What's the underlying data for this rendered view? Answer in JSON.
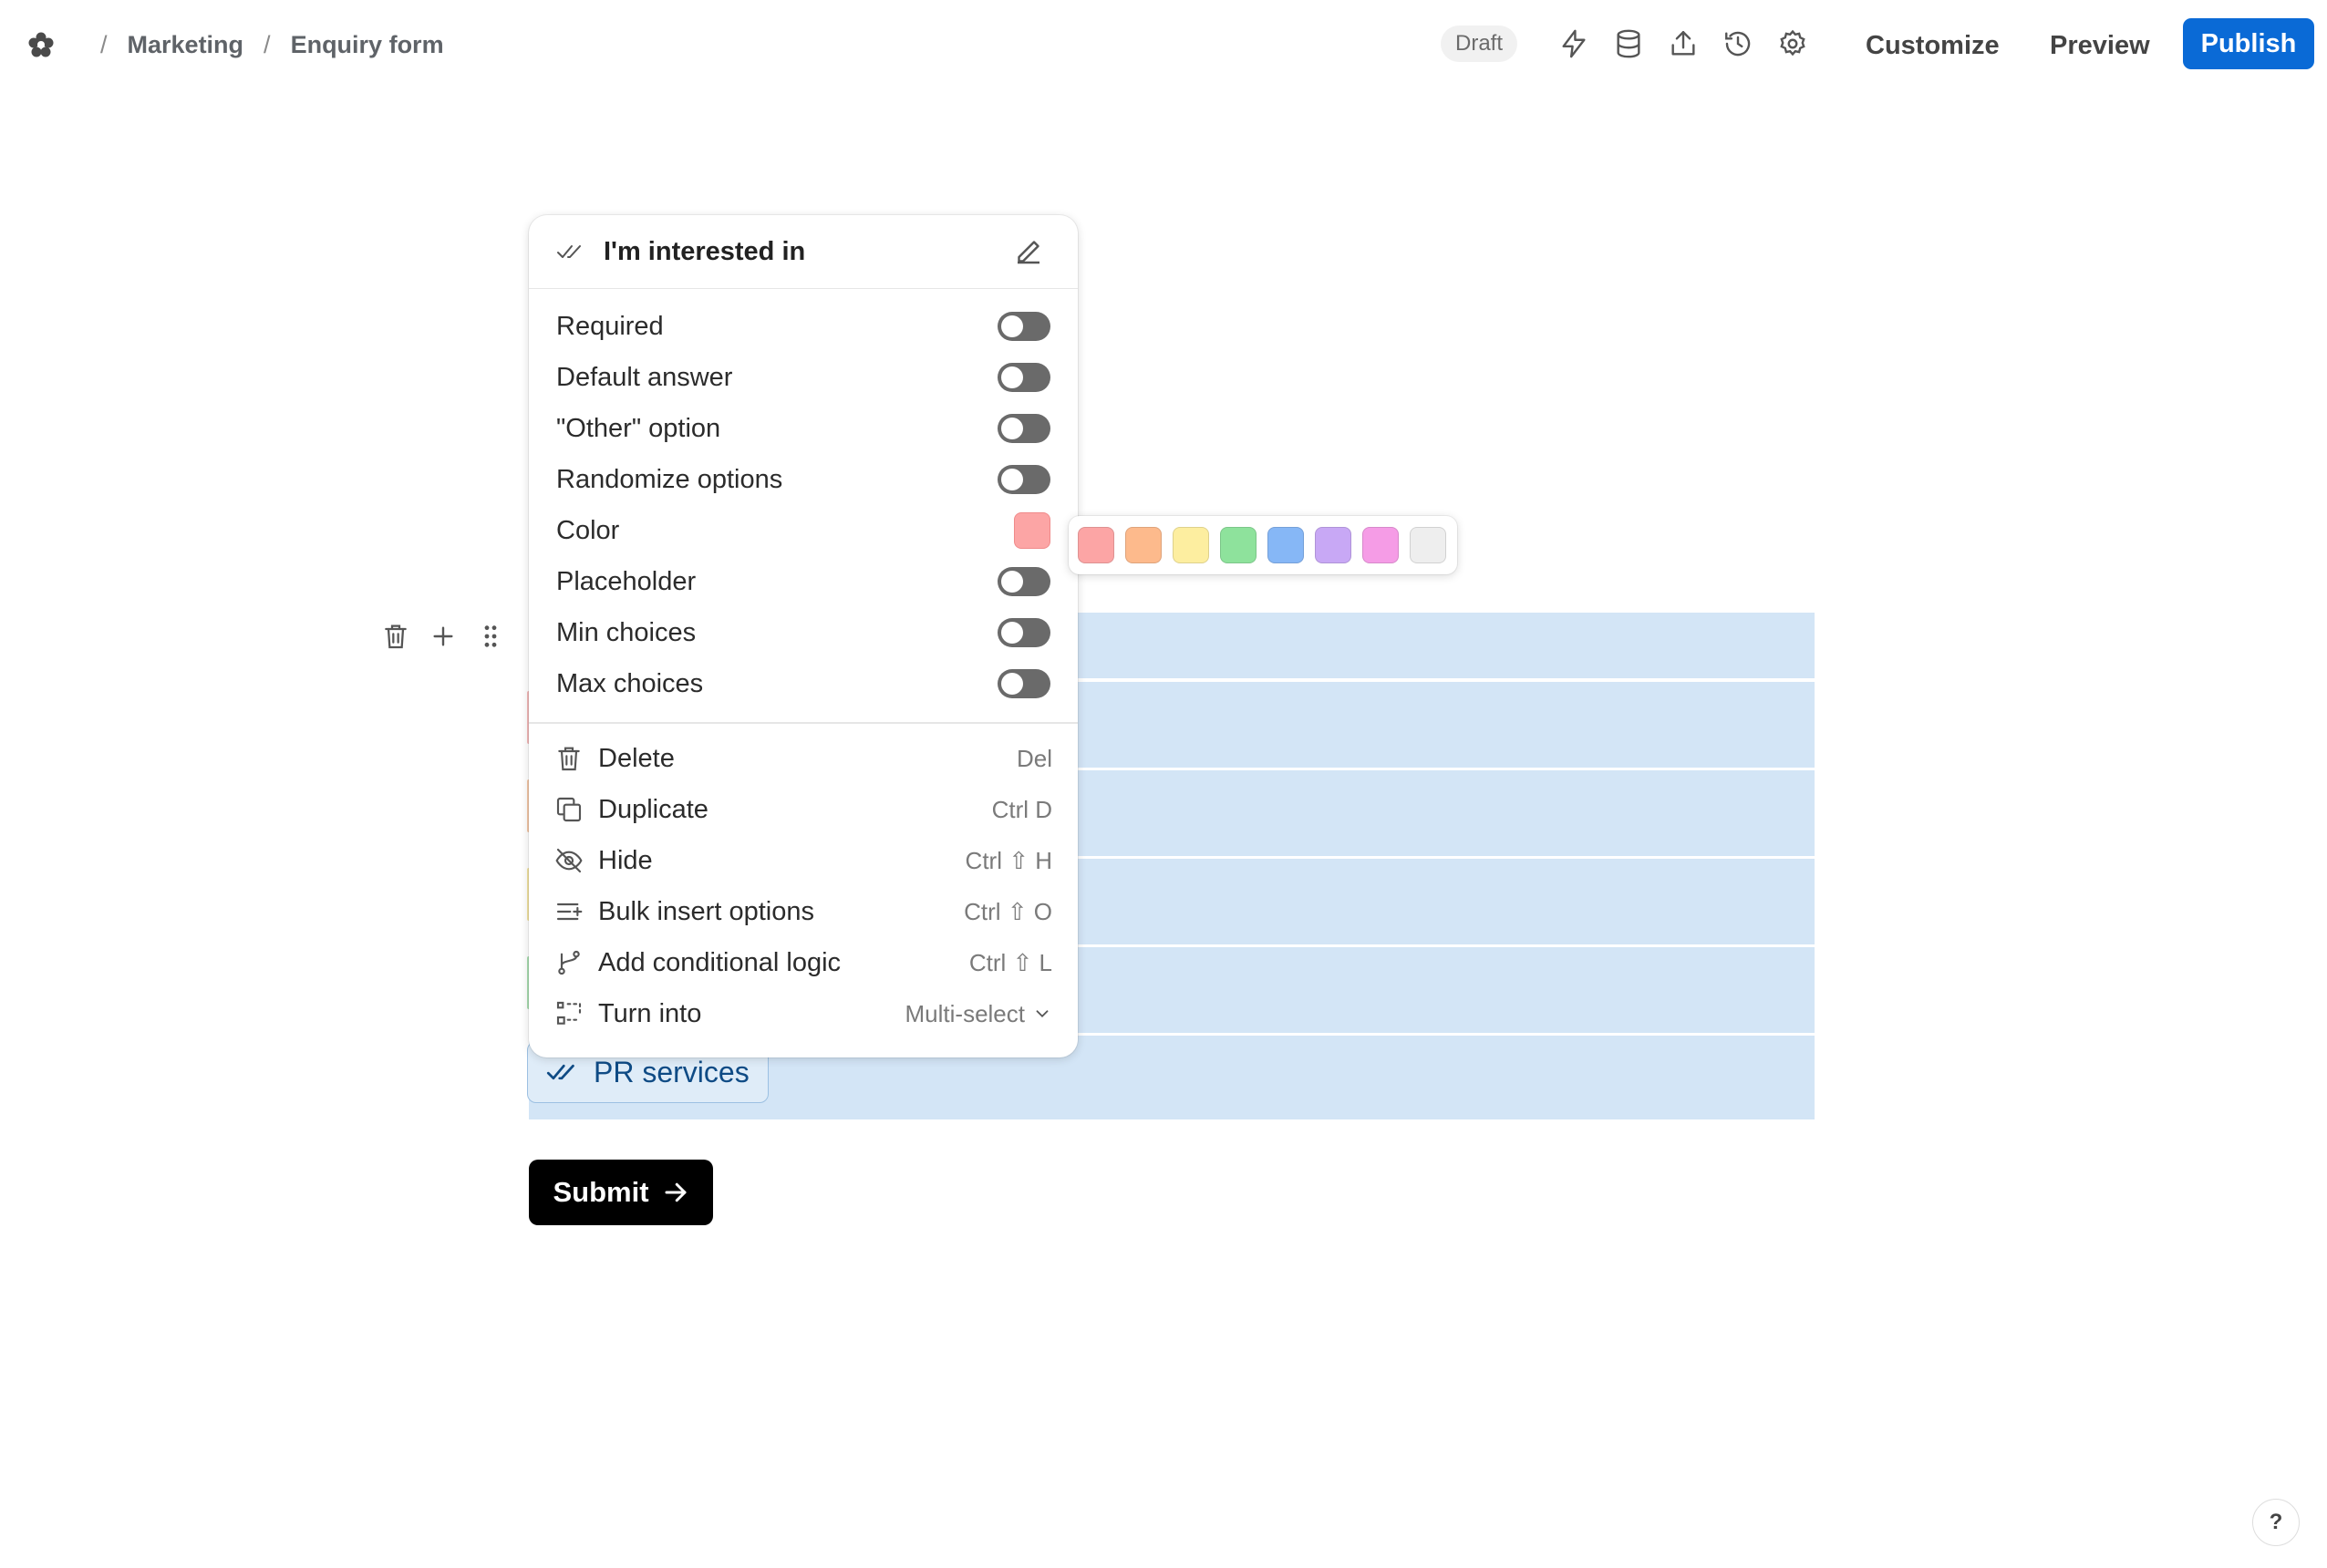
{
  "breadcrumb": {
    "workspace": "Marketing",
    "page": "Enquiry form"
  },
  "status": "Draft",
  "toolbar": {
    "customize": "Customize",
    "preview": "Preview",
    "publish": "Publish"
  },
  "field": {
    "title": "I'm interested in",
    "settings": [
      {
        "label": "Required",
        "on": false
      },
      {
        "label": "Default answer",
        "on": false
      },
      {
        "label": "\"Other\" option",
        "on": false
      },
      {
        "label": "Randomize options",
        "on": false
      },
      {
        "label": "Color",
        "value": "#fca5a5"
      },
      {
        "label": "Placeholder",
        "on": false
      },
      {
        "label": "Min choices",
        "on": false
      },
      {
        "label": "Max choices",
        "on": false
      }
    ],
    "actions": [
      {
        "label": "Delete",
        "shortcut": "Del",
        "icon": "trash-icon"
      },
      {
        "label": "Duplicate",
        "shortcut": "Ctrl D",
        "icon": "copy-icon"
      },
      {
        "label": "Hide",
        "shortcut": "Ctrl ⇧ H",
        "icon": "eye-off-icon"
      },
      {
        "label": "Bulk insert options",
        "shortcut": "Ctrl ⇧ O",
        "icon": "list-plus-icon"
      },
      {
        "label": "Add conditional logic",
        "shortcut": "Ctrl ⇧ L",
        "icon": "branch-icon"
      },
      {
        "label": "Turn into",
        "value": "Multi-select",
        "icon": "transform-icon"
      }
    ]
  },
  "palette": [
    "#fca5a5",
    "#fdba8c",
    "#fdeea0",
    "#8ee29c",
    "#86b7f6",
    "#c8a8f5",
    "#f59ce6",
    "#eeeeee"
  ],
  "visible_option": "PR services",
  "submit": "Submit",
  "help": "?"
}
